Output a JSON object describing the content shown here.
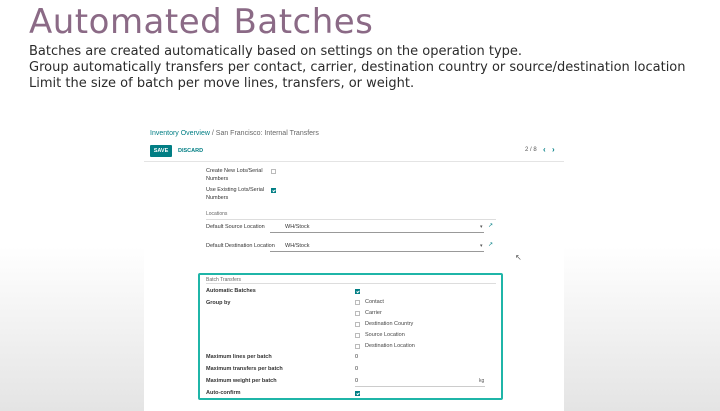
{
  "slide": {
    "title": "Automated Batches",
    "bullets": [
      "Batches are created automatically based on settings on the operation type.",
      "Group automatically transfers per contact, carrier, destination country or source/destination location",
      "Limit the size of batch per move lines, transfers, or weight."
    ]
  },
  "app": {
    "breadcrumb": {
      "parent": "Inventory Overview",
      "separator": "/",
      "current": "San Francisco: Internal Transfers"
    },
    "toolbar": {
      "save_label": "SAVE",
      "discard_label": "DISCARD",
      "pager": "2 / 8",
      "prev_icon": "‹",
      "next_icon": "›"
    },
    "lots": {
      "create_label": "Create New Lots/Serial Numbers",
      "create_checked": false,
      "use_existing_label": "Use Existing Lots/Serial Numbers",
      "use_existing_checked": true
    },
    "locations": {
      "section_title": "Locations",
      "default_source_label": "Default Source Location",
      "default_source_value": "WH/Stock",
      "default_dest_label": "Default Destination Location",
      "default_dest_value": "WH/Stock"
    },
    "batch": {
      "section_title": "Batch Transfers",
      "automatic_label": "Automatic Batches",
      "automatic_checked": true,
      "group_by_label": "Group by",
      "group_options": [
        {
          "label": "Contact",
          "checked": false
        },
        {
          "label": "Carrier",
          "checked": false
        },
        {
          "label": "Destination Country",
          "checked": false
        },
        {
          "label": "Source Location",
          "checked": false
        },
        {
          "label": "Destination Location",
          "checked": false
        }
      ],
      "max_lines_label": "Maximum lines per batch",
      "max_lines_value": "0",
      "max_transfers_label": "Maximum transfers per batch",
      "max_transfers_value": "0",
      "max_weight_label": "Maximum weight per batch",
      "max_weight_value": "0",
      "weight_unit": "kg",
      "auto_confirm_label": "Auto-confirm",
      "auto_confirm_checked": true
    }
  },
  "colors": {
    "title": "#8b6a86",
    "accent": "#017e84",
    "highlight": "#1fb5a8"
  }
}
